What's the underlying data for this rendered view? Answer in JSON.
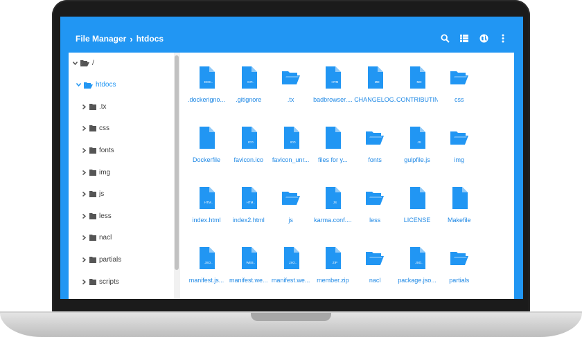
{
  "colors": {
    "accent": "#2196f3",
    "link": "#1e88e5",
    "text": "#424242"
  },
  "appbar": {
    "title": "File Manager",
    "current": "htdocs",
    "icons": [
      "search-icon",
      "list-view-icon",
      "globe-icon",
      "more-vert-icon"
    ]
  },
  "tree": [
    {
      "label": "/",
      "expanded": true,
      "active": false
    },
    {
      "label": "htdocs",
      "expanded": true,
      "active": true
    },
    {
      "label": ".tx",
      "expanded": false,
      "active": false
    },
    {
      "label": "css",
      "expanded": false,
      "active": false
    },
    {
      "label": "fonts",
      "expanded": false,
      "active": false
    },
    {
      "label": "img",
      "expanded": false,
      "active": false
    },
    {
      "label": "js",
      "expanded": false,
      "active": false
    },
    {
      "label": "less",
      "expanded": false,
      "active": false
    },
    {
      "label": "nacl",
      "expanded": false,
      "active": false
    },
    {
      "label": "partials",
      "expanded": false,
      "active": false
    },
    {
      "label": "scripts",
      "expanded": false,
      "active": false
    }
  ],
  "files": [
    {
      "name": ".dockerigno...",
      "type": "file",
      "tag": "DOC.."
    },
    {
      "name": ".gitignore",
      "type": "file",
      "tag": "GIT.."
    },
    {
      "name": ".tx",
      "type": "folder",
      "tag": ""
    },
    {
      "name": "badbrowser....",
      "type": "file",
      "tag": "HTM"
    },
    {
      "name": "CHANGELOG.m",
      "type": "file",
      "tag": "MD"
    },
    {
      "name": "CONTRIBUTIN..",
      "type": "file",
      "tag": "MD"
    },
    {
      "name": "css",
      "type": "folder",
      "tag": ""
    },
    {
      "name": "Dockerfile",
      "type": "file",
      "tag": ""
    },
    {
      "name": "favicon.ico",
      "type": "file",
      "tag": "ICO"
    },
    {
      "name": "favicon_unr...",
      "type": "file",
      "tag": "ICO"
    },
    {
      "name": "files for y...",
      "type": "file",
      "tag": ""
    },
    {
      "name": "fonts",
      "type": "folder",
      "tag": ""
    },
    {
      "name": "gulpfile.js",
      "type": "file",
      "tag": "JS"
    },
    {
      "name": "img",
      "type": "folder",
      "tag": ""
    },
    {
      "name": "index.html",
      "type": "file",
      "tag": "HTM.."
    },
    {
      "name": "index2.html",
      "type": "file",
      "tag": "HTM.."
    },
    {
      "name": "js",
      "type": "folder",
      "tag": ""
    },
    {
      "name": "karma.conf....",
      "type": "file",
      "tag": "JS"
    },
    {
      "name": "less",
      "type": "folder",
      "tag": ""
    },
    {
      "name": "LICENSE",
      "type": "file",
      "tag": ""
    },
    {
      "name": "Makefile",
      "type": "file",
      "tag": ""
    },
    {
      "name": "manifest.js...",
      "type": "file",
      "tag": "JSO.."
    },
    {
      "name": "manifest.we...",
      "type": "file",
      "tag": "WEB.."
    },
    {
      "name": "manifest.we...",
      "type": "file",
      "tag": "JSO.."
    },
    {
      "name": "member.zip",
      "type": "file",
      "tag": "ZIP"
    },
    {
      "name": "nacl",
      "type": "folder",
      "tag": ""
    },
    {
      "name": "package.jso...",
      "type": "file",
      "tag": "JSO.."
    },
    {
      "name": "partials",
      "type": "folder",
      "tag": ""
    }
  ]
}
